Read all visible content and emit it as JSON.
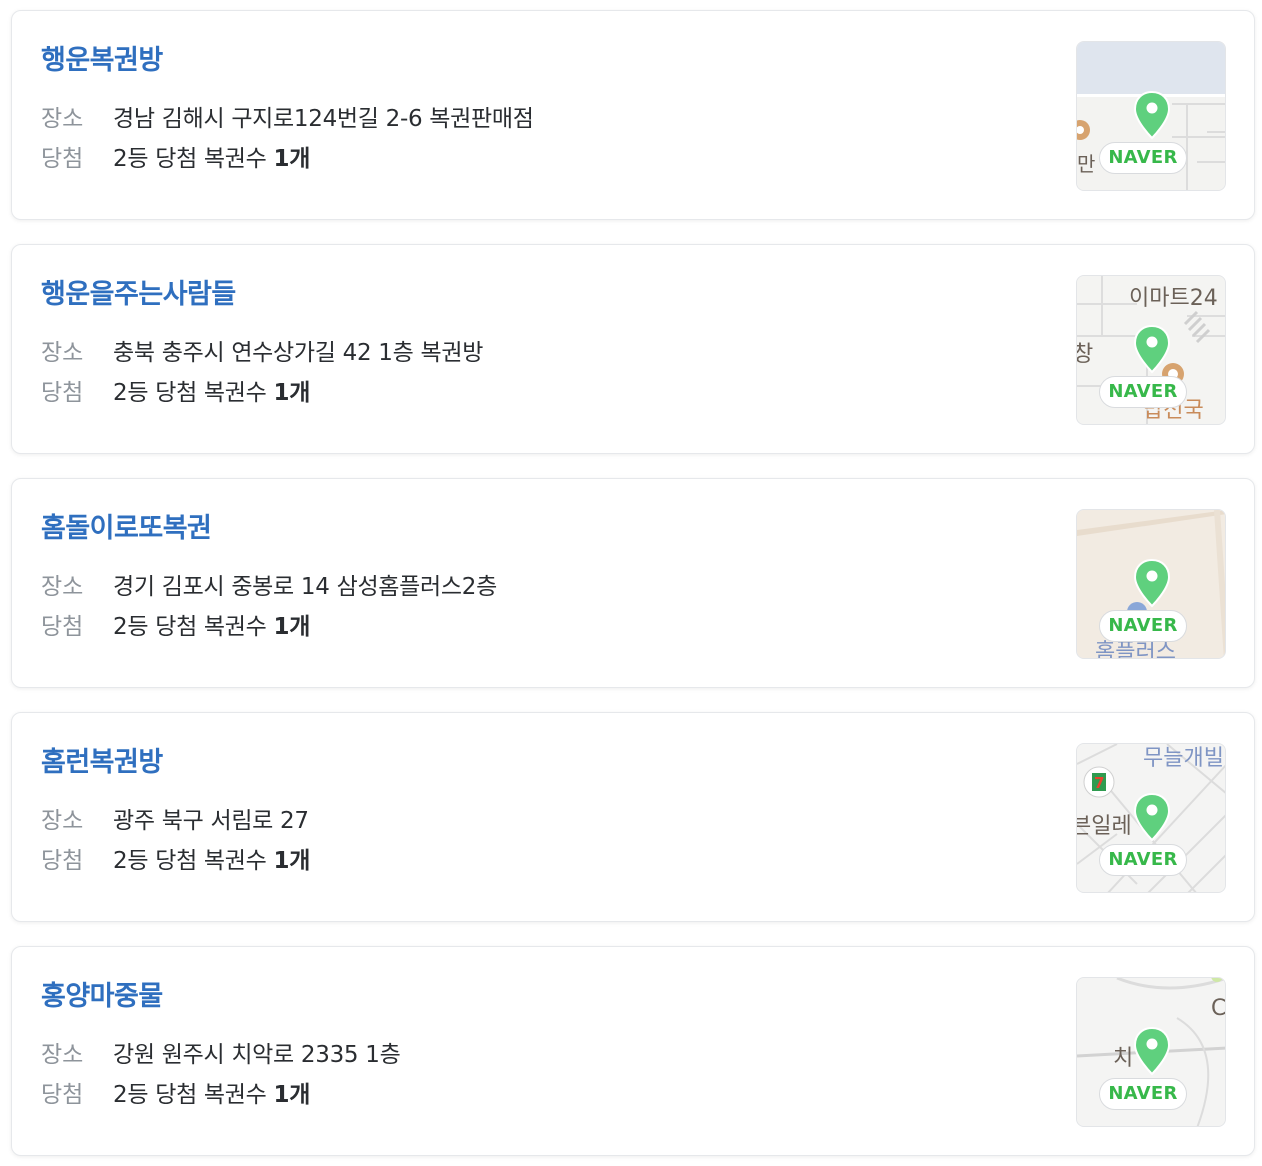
{
  "labels": {
    "place": "장소",
    "win": "당첨"
  },
  "map_brand": "NAVER",
  "colors": {
    "shop_name": "#2f6fbf",
    "pin": "#5fd07e",
    "naver_green": "#37b84a"
  },
  "shops": [
    {
      "name": "행운복권방",
      "address": "경남 김해시 구지로124번길 2-6 복권판매점",
      "win_prefix": "2등 당첨 복권수",
      "win_count": "1개",
      "map_labels": [
        "만"
      ]
    },
    {
      "name": "행운을주는사람들",
      "address": "충북 충주시 연수상가길 42 1층 복권방",
      "win_prefix": "2등 당첨 복권수",
      "win_count": "1개",
      "map_labels": [
        "이마트24",
        "창",
        "밥선국"
      ]
    },
    {
      "name": "홈돌이로또복권",
      "address": "경기 김포시 중봉로 14 삼성홈플러스2층",
      "win_prefix": "2등 당첨 복권수",
      "win_count": "1개",
      "map_labels": [
        "홈플러스"
      ]
    },
    {
      "name": "홈런복권방",
      "address": "광주 북구 서림로 27",
      "win_prefix": "2등 당첨 복권수",
      "win_count": "1개",
      "map_labels": [
        "무늘개빌",
        "븐일레"
      ]
    },
    {
      "name": "홍양마중물",
      "address": "강원 원주시 치악로 2335 1층",
      "win_prefix": "2등 당첨 복권수",
      "win_count": "1개",
      "map_labels": [
        "치",
        "C"
      ]
    }
  ]
}
